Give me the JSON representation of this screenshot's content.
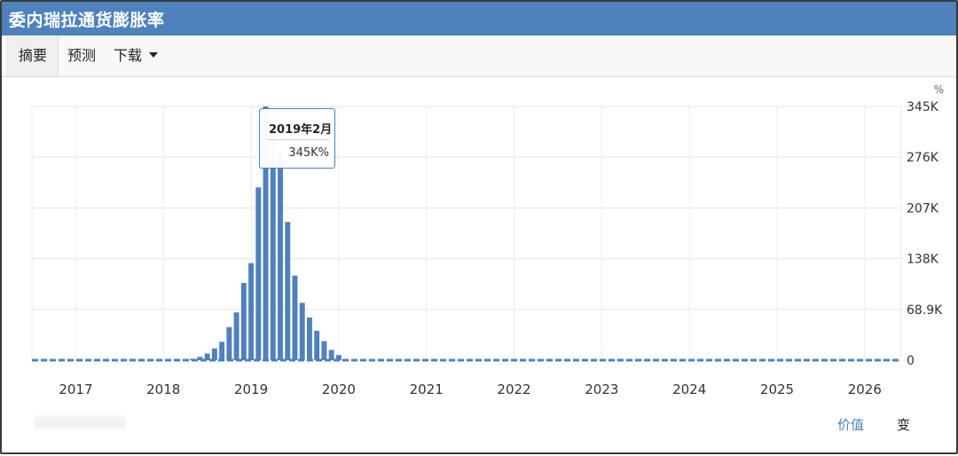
{
  "header": {
    "title": "委内瑞拉通货膨胀率"
  },
  "tabs": [
    {
      "label": "摘要",
      "active": true
    },
    {
      "label": "预测",
      "active": false
    },
    {
      "label": "下载",
      "active": false,
      "icon": "caret-down-icon"
    }
  ],
  "chart_data": {
    "type": "bar",
    "unit": "%",
    "x_ticks": [
      "2017",
      "2018",
      "2019",
      "2020",
      "2021",
      "2022",
      "2023",
      "2024",
      "2025",
      "2026"
    ],
    "y_ticks": [
      "0",
      "68.9K",
      "138K",
      "207K",
      "276K",
      "345K"
    ],
    "ylim": [
      0,
      345000
    ],
    "xlim": [
      "2016-07",
      "2026-06"
    ],
    "grid": true,
    "bar_color": "#4f81bd",
    "bars": [
      {
        "month": "2018-05",
        "value": 2000
      },
      {
        "month": "2018-06",
        "value": 4500
      },
      {
        "month": "2018-07",
        "value": 9000
      },
      {
        "month": "2018-08",
        "value": 16000
      },
      {
        "month": "2018-09",
        "value": 25000
      },
      {
        "month": "2018-10",
        "value": 45000
      },
      {
        "month": "2018-11",
        "value": 65000
      },
      {
        "month": "2018-12",
        "value": 105000
      },
      {
        "month": "2019-01",
        "value": 132000
      },
      {
        "month": "2019-02",
        "value": 235000
      },
      {
        "month": "2019-03",
        "value": 345000
      },
      {
        "month": "2019-04",
        "value": 330000
      },
      {
        "month": "2019-05",
        "value": 285000
      },
      {
        "month": "2019-06",
        "value": 188000
      },
      {
        "month": "2019-07",
        "value": 115000
      },
      {
        "month": "2019-08",
        "value": 78000
      },
      {
        "month": "2019-09",
        "value": 58000
      },
      {
        "month": "2019-10",
        "value": 40000
      },
      {
        "month": "2019-11",
        "value": 26000
      },
      {
        "month": "2019-12",
        "value": 14000
      },
      {
        "month": "2020-01",
        "value": 7000
      }
    ],
    "baseline_dashed": true,
    "tooltip": {
      "date": "2019年2月",
      "value": "345K%"
    }
  },
  "footer": {
    "value_link": "价值",
    "change_link": "变"
  },
  "colors": {
    "brand": "#4f81bd",
    "grid": "#e6e6e6"
  }
}
